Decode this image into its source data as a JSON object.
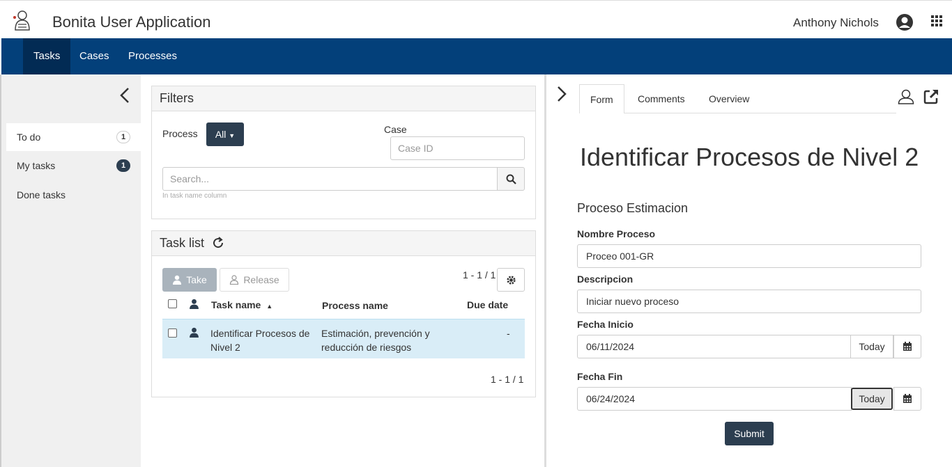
{
  "header": {
    "app_title": "Bonita User Application",
    "user_name": "Anthony Nichols",
    "icons": [
      "bonita-logo-icon",
      "user-avatar-icon",
      "apps-grid-icon"
    ]
  },
  "nav": {
    "tasks": "Tasks",
    "cases": "Cases",
    "processes": "Processes",
    "accent_color": "#03407a"
  },
  "sidebar": {
    "items": [
      {
        "label": "To do",
        "count": "1"
      },
      {
        "label": "My tasks",
        "count": "1"
      },
      {
        "label": "Done tasks",
        "count": ""
      }
    ]
  },
  "filters": {
    "title": "Filters",
    "process_label": "Process",
    "process_value": "All",
    "case_label": "Case",
    "case_placeholder": "Case ID",
    "search_placeholder": "Search...",
    "search_hint": "In task name column"
  },
  "tasklist": {
    "title": "Task list",
    "take": "Take",
    "release": "Release",
    "pagination_top": "1 - 1 / 1",
    "pagination_bottom": "1 - 1 / 1",
    "columns": {
      "task_name": "Task name",
      "process_name": "Process name",
      "due_date": "Due date"
    },
    "rows": [
      {
        "task_line1": "Identificar Procesos de",
        "task_line2": "Nivel 2",
        "process_line1": "Estimación, prevención y",
        "process_line2": "reducción de riesgos",
        "due": "-"
      }
    ]
  },
  "detail": {
    "tabs": {
      "form": "Form",
      "comments": "Comments",
      "overview": "Overview"
    },
    "form_title": "Identificar Procesos de Nivel 2",
    "form_subtitle": "Proceso Estimacion",
    "fields": {
      "nombre_label": "Nombre Proceso",
      "nombre_value": "Proceo 001-GR",
      "descripcion_label": "Descripcion",
      "descripcion_value": "Iniciar nuevo proceso",
      "inicio_label": "Fecha Inicio",
      "inicio_value": "06/11/2024",
      "fin_label": "Fecha Fin",
      "fin_value": "06/24/2024",
      "today_label": "Today"
    },
    "submit": "Submit"
  }
}
